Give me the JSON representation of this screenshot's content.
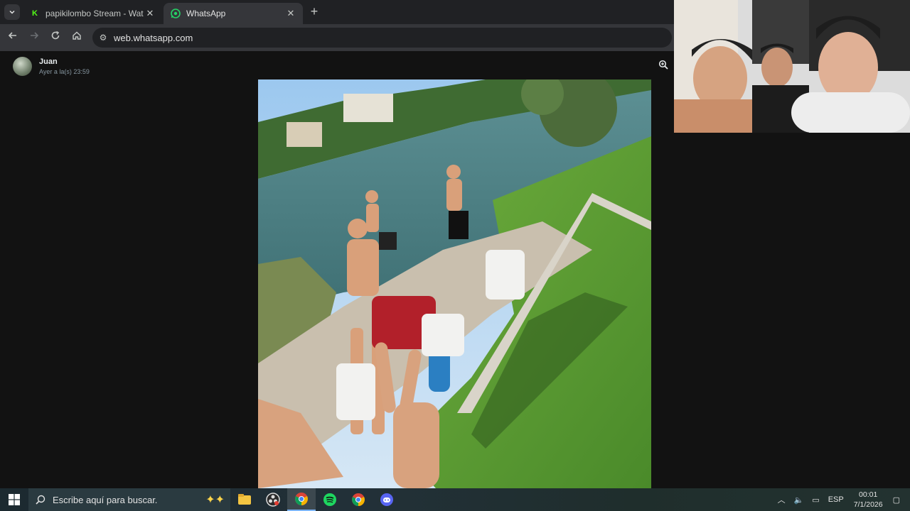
{
  "browser": {
    "tabs": [
      {
        "title": "papikilombo Stream - Watch Li",
        "favicon": "kick-icon",
        "active": false
      },
      {
        "title": "WhatsApp",
        "favicon": "whatsapp-icon",
        "active": true
      }
    ],
    "url": "web.whatsapp.com"
  },
  "viewer": {
    "sender_name": "Juan",
    "sender_time": "Ayer a la(s) 23:59"
  },
  "taskbar": {
    "search_placeholder": "Escribe aquí para buscar.",
    "language": "ESP",
    "time": "00:01",
    "date": "7/1/2026",
    "apps": [
      "file-explorer-icon",
      "obs-icon",
      "chrome-icon",
      "spotify-icon",
      "chrome-icon",
      "discord-icon"
    ]
  },
  "colors": {
    "whatsapp_green": "#25d366",
    "kick_green": "#53fc18",
    "chrome_dark": "#202124"
  }
}
